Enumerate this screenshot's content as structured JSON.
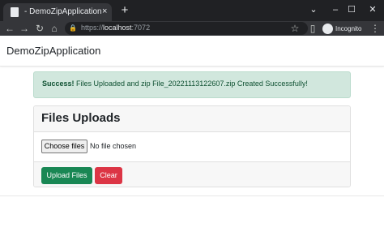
{
  "browser": {
    "tab_title": "- DemoZipApplication",
    "tab_close": "×",
    "new_tab": "+",
    "url_scheme": "https://",
    "url_host": "localhost",
    "url_port": ":7072",
    "incognito_label": "Incognito",
    "window_controls": {
      "minimize": "–",
      "maximize": "☐",
      "close": "✕"
    },
    "icons": {
      "back": "←",
      "forward": "→",
      "reload": "↻",
      "home": "⌂",
      "lock": "🔒",
      "star": "☆",
      "sidepanel": "▯",
      "menu": "⋮",
      "tab_list": "⌄"
    }
  },
  "navbar": {
    "brand": "DemoZipApplication"
  },
  "alert": {
    "strong": "Success!",
    "message": " Files Uploaded and zip File_20221113122607.zip Created Successfully!"
  },
  "card": {
    "title": "Files Uploads",
    "choose_button": "Choose files",
    "file_status": "No file chosen",
    "upload_button": "Upload Files",
    "clear_button": "Clear"
  },
  "colors": {
    "success_bg": "#d1e7dd",
    "success_text": "#0f5132",
    "upload_button": "#198754",
    "clear_button": "#dc3545"
  }
}
